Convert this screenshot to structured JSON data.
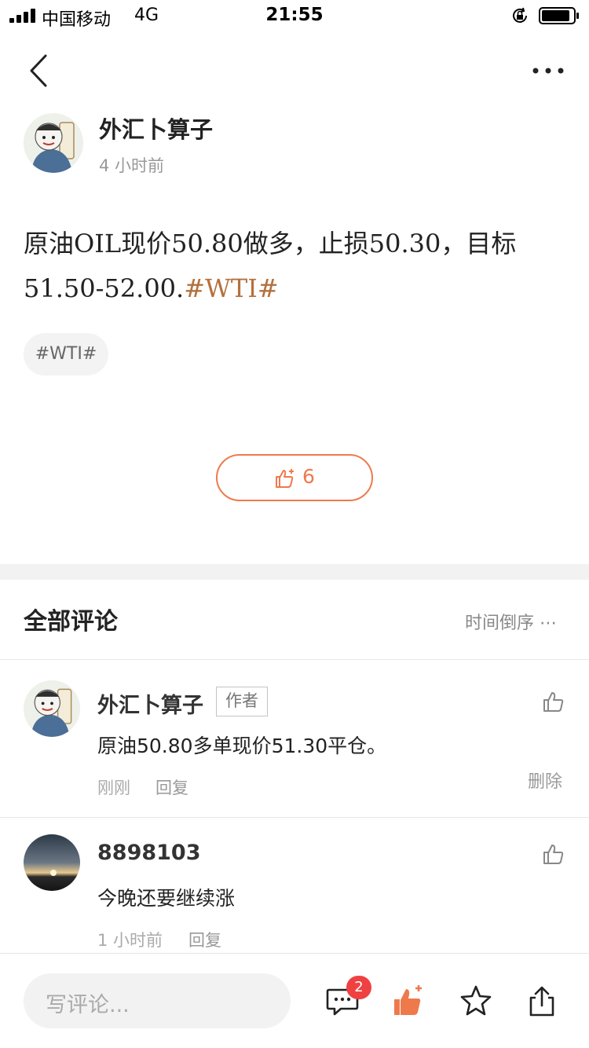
{
  "status_bar": {
    "carrier": "中国移动",
    "network": "4G",
    "time": "21:55"
  },
  "post": {
    "author_name": "外汇卜算子",
    "time_ago": "4 小时前",
    "body_text": "原油OIL现价50.80做多，止损50.30，目标51.50-52.00.",
    "body_hashtag": "#WTI#",
    "tag_chip": "#WTI#",
    "like_count": "6"
  },
  "comments_section": {
    "title": "全部评论",
    "sort_label": "时间倒序 ⋯",
    "items": [
      {
        "name": "外汇卜算子",
        "badge": "作者",
        "text": "原油50.80多单现价51.30平仓。",
        "time": "刚刚",
        "reply": "回复",
        "delete": "删除"
      },
      {
        "name": "8898103",
        "text": "今晚还要继续涨",
        "time": "1 小时前",
        "reply": "回复"
      }
    ]
  },
  "bottom_bar": {
    "input_placeholder": "写评论...",
    "comment_badge": "2"
  },
  "colors": {
    "accent": "#ee7a4c",
    "hashtag": "#b4703c",
    "badge": "#f04142"
  },
  "icons": [
    "back-icon",
    "more-icon",
    "thumb-up-icon",
    "comment-icon",
    "star-icon",
    "share-icon"
  ]
}
